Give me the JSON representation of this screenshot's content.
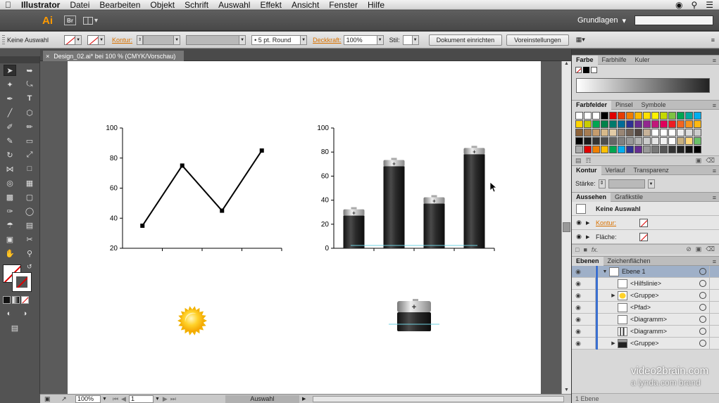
{
  "menubar": {
    "app": "Illustrator",
    "items": [
      "Datei",
      "Bearbeiten",
      "Objekt",
      "Schrift",
      "Auswahl",
      "Effekt",
      "Ansicht",
      "Fenster",
      "Hilfe"
    ]
  },
  "appbar": {
    "logo": "Ai",
    "bridge": "Br",
    "workspace": "Grundlagen"
  },
  "control": {
    "selection": "Keine Auswahl",
    "stroke_label": "Kontur:",
    "brush": "5 pt. Round",
    "opacity_label": "Deckkraft:",
    "opacity_value": "100%",
    "style_label": "Stil:",
    "doc_setup": "Dokument einrichten",
    "prefs": "Voreinstellungen"
  },
  "document": {
    "tab_title": "Design_02.ai* bei 100 % (CMYK/Vorschau)"
  },
  "chart_data": [
    {
      "type": "line",
      "x": [
        1,
        2,
        3,
        4
      ],
      "values": [
        35,
        75,
        45,
        85
      ],
      "ylim": [
        20,
        100
      ],
      "yticks": [
        "20",
        "40",
        "60",
        "80",
        "100"
      ]
    },
    {
      "type": "bar",
      "categories": [
        "",
        "",
        "",
        ""
      ],
      "values": [
        33,
        74,
        43,
        84
      ],
      "ylim": [
        0,
        100
      ],
      "yticks": [
        "0",
        "20",
        "40",
        "60",
        "80",
        "100"
      ]
    }
  ],
  "panels": {
    "color_tabs": [
      "Farbe",
      "Farbhilfe",
      "Kuler"
    ],
    "swatch_tabs": [
      "Farbfelder",
      "Pinsel",
      "Symbole"
    ],
    "stroke_tabs": [
      "Kontur",
      "Verlauf",
      "Transparenz"
    ],
    "stroke_weight_label": "Stärke:",
    "appearance_tabs": [
      "Aussehen",
      "Grafikstile"
    ],
    "appearance_title": "Keine Auswahl",
    "appearance_stroke": "Kontur:",
    "appearance_fill": "Fläche:",
    "layers_tabs": [
      "Ebenen",
      "Zeichenflächen"
    ],
    "layers": [
      "Ebene 1",
      "<Hilfslinie>",
      "<Gruppe>",
      "<Pfad>",
      "<Diagramm>",
      "<Diagramm>",
      "<Gruppe>"
    ],
    "layers_count": "1 Ebene"
  },
  "status": {
    "zoom": "100%",
    "page": "1",
    "mode": "Auswahl"
  },
  "watermark": {
    "brand": "video2brain.com",
    "sub": "a lynda.com brand"
  },
  "colors": {
    "orange_label": "#d97200",
    "layer_highlight": "#3a6fd0",
    "sun": "#ffc20e"
  }
}
